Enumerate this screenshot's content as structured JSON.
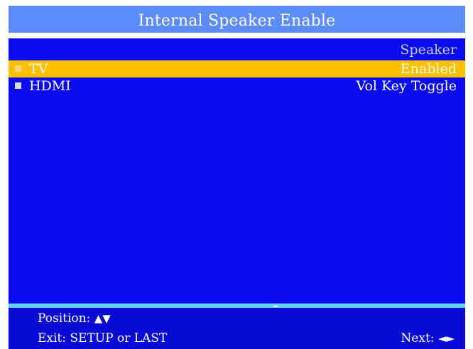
{
  "title": "Internal Speaker Enable",
  "column_header": "Speaker",
  "items": [
    {
      "label": "TV",
      "value": "Enabled",
      "selected": true
    },
    {
      "label": "HDMI",
      "value": "Vol Key Toggle",
      "selected": false
    }
  ],
  "footer": {
    "position_label": "Position:",
    "position_arrows": "▲▼",
    "exit_label": "Exit: SETUP or LAST",
    "next_label": "Next:",
    "next_arrows": "◄►"
  },
  "colors": {
    "title_bar": "#5c8cfa",
    "main_background": "#0b0bf0",
    "selected_row": "#ffc000",
    "divider": "#59d6f4",
    "footer_background": "#0a0ad6"
  }
}
